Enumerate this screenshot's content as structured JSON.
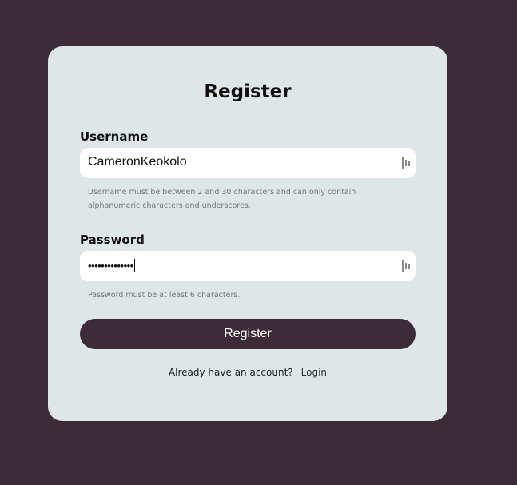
{
  "form": {
    "title": "Register",
    "username": {
      "label": "Username",
      "value": "CameronKeokolo",
      "helper": "Username must be between 2 and 30 characters and can only contain alphanumeric characters and underscores.",
      "icon": "password-manager-icon"
    },
    "password": {
      "label": "Password",
      "masked_value": "••••••••••••••",
      "helper": "Password must be at least 6 characters.",
      "icon": "password-manager-icon"
    },
    "submit_label": "Register",
    "footer_text": "Already have an account?",
    "login_link": "Login"
  },
  "colors": {
    "page_background": "#3d2c37",
    "card_background": "#dfe6e7",
    "button_background": "#3d2c37",
    "input_background": "#ffffff"
  }
}
